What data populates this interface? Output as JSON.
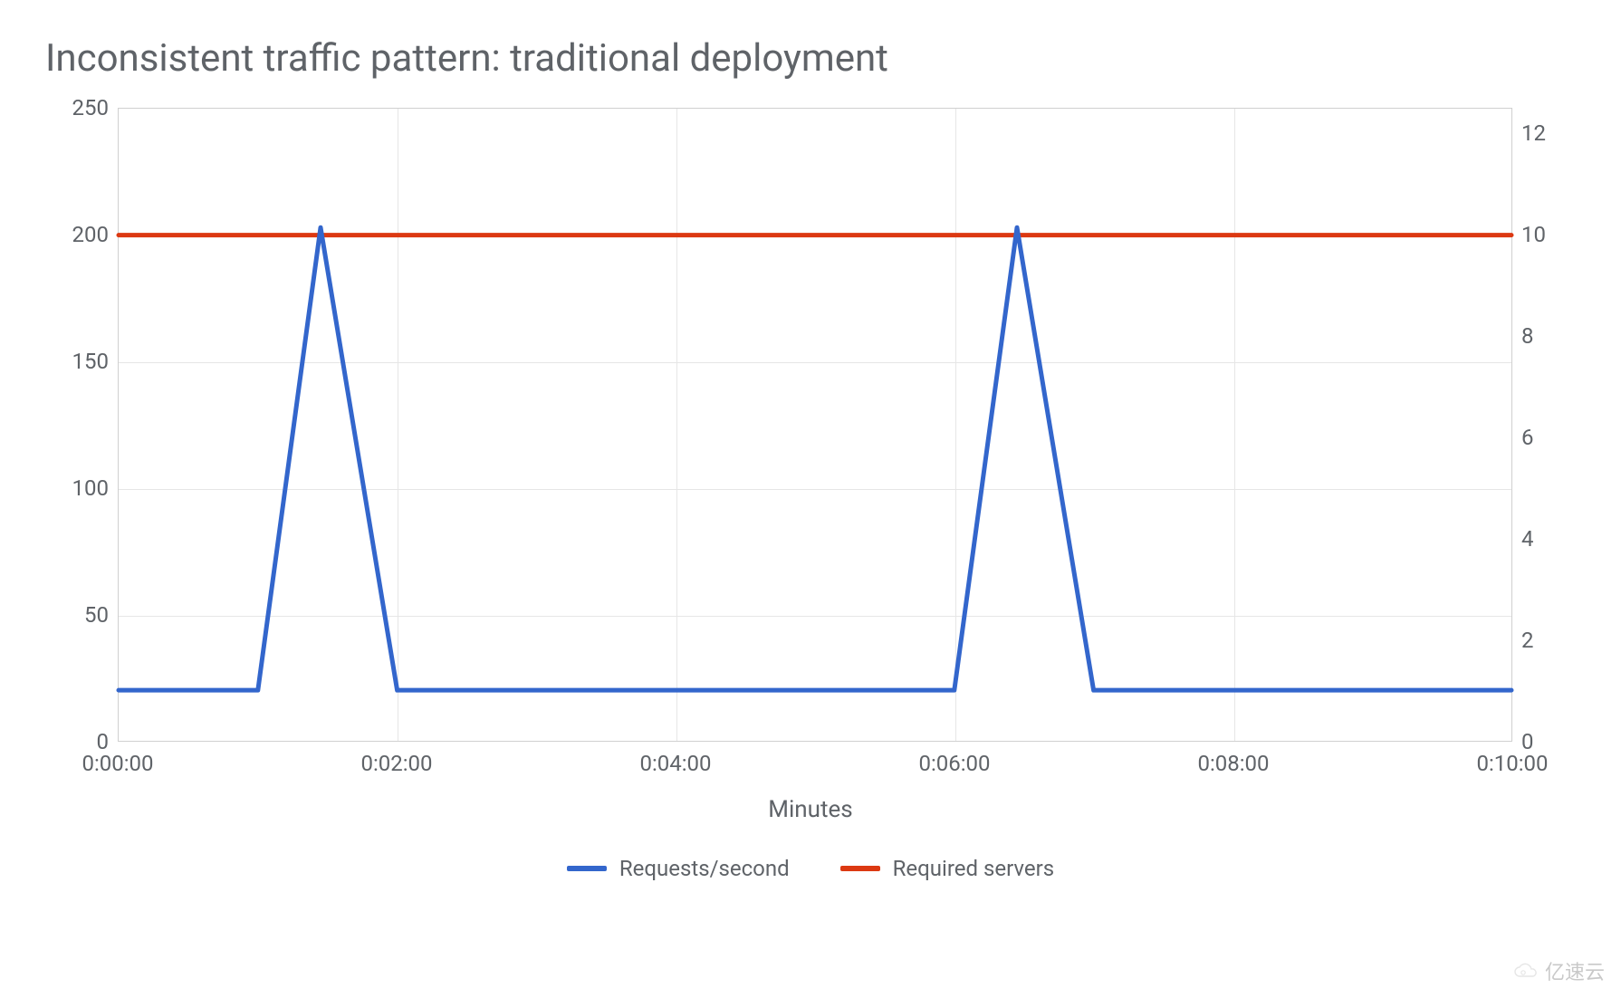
{
  "title": "Inconsistent traffic pattern: traditional deployment",
  "xlabel": "Minutes",
  "legend": {
    "series1": "Requests/second",
    "series2": "Required servers"
  },
  "colors": {
    "requests": "#3366cc",
    "servers": "#dc3912"
  },
  "watermark": "亿速云",
  "chart_data": {
    "type": "line",
    "xlabel": "Minutes",
    "left_axis": {
      "label": "",
      "min": 0,
      "max": 250,
      "ticks": [
        0,
        50,
        100,
        150,
        200,
        250
      ]
    },
    "right_axis": {
      "label": "",
      "min": 0,
      "max": 12.5,
      "ticks": [
        0,
        2,
        4,
        6,
        8,
        10,
        12
      ]
    },
    "x_ticks": [
      "0:00:00",
      "0:02:00",
      "0:04:00",
      "0:06:00",
      "0:08:00",
      "0:10:00"
    ],
    "x_minutes": [
      0,
      1,
      1.45,
      2,
      3,
      4,
      5,
      6,
      6.45,
      7,
      8,
      9,
      10
    ],
    "series": [
      {
        "name": "Requests/second",
        "axis": "left",
        "values": [
          20,
          20,
          203,
          20,
          20,
          20,
          20,
          20,
          203,
          20,
          20,
          20,
          20
        ]
      },
      {
        "name": "Required servers",
        "axis": "right",
        "values": [
          10,
          10,
          10,
          10,
          10,
          10,
          10,
          10,
          10,
          10,
          10,
          10,
          10
        ]
      }
    ]
  },
  "ticks": {
    "yl": [
      "0",
      "50",
      "100",
      "150",
      "200",
      "250"
    ],
    "yr": [
      "0",
      "2",
      "4",
      "6",
      "8",
      "10",
      "12"
    ],
    "x": [
      "0:00:00",
      "0:02:00",
      "0:04:00",
      "0:06:00",
      "0:08:00",
      "0:10:00"
    ]
  }
}
